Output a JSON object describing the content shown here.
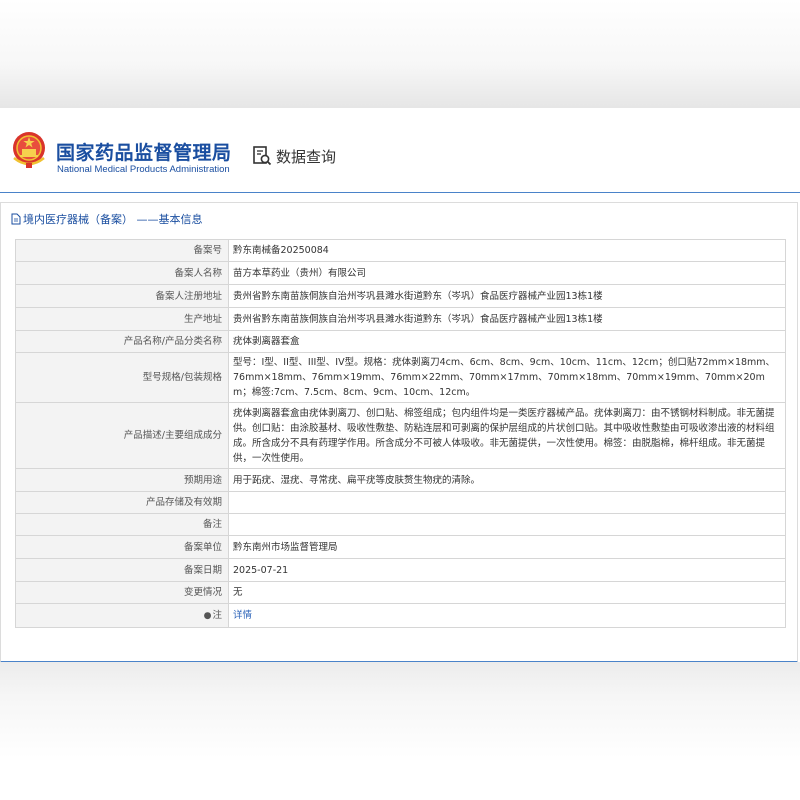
{
  "header": {
    "agency_cn": "国家药品监督管理局",
    "agency_en": "National Medical Products Administration",
    "query_label": "数据查询"
  },
  "section": {
    "title": "境内医疗器械（备案） ——基本信息"
  },
  "rows": [
    {
      "label": "备案号",
      "value": "黔东南械备20250084"
    },
    {
      "label": "备案人名称",
      "value": "苗方本草药业（贵州）有限公司"
    },
    {
      "label": "备案人注册地址",
      "value": "贵州省黔东南苗族侗族自治州岑巩县濉水街道黔东（岑巩）食品医疗器械产业园13栋1楼"
    },
    {
      "label": "生产地址",
      "value": "贵州省黔东南苗族侗族自治州岑巩县濉水街道黔东（岑巩）食品医疗器械产业园13栋1楼"
    },
    {
      "label": "产品名称/产品分类名称",
      "value": "疣体剥离器套盒"
    },
    {
      "label": "型号规格/包装规格",
      "value": "型号：I型、II型、III型、IV型。规格：疣体剥离刀4cm、6cm、8cm、9cm、10cm、11cm、12cm；创口贴72mm×18mm、76mm×18mm、76mm×19mm、76mm×22mm、70mm×17mm、70mm×18mm、70mm×19mm、70mm×20mm；棉签:7cm、7.5cm、8cm、9cm、10cm、12cm。"
    },
    {
      "label": "产品描述/主要组成成分",
      "value": "疣体剥离器套盒由疣体剥离刀、创口贴、棉签组成；包内组件均是一类医疗器械产品。疣体剥离刀：由不锈钢材料制成。非无菌提供。创口贴：由涂胶基材、吸收性敷垫、防粘连层和可剥离的保护层组成的片状创口贴。其中吸收性敷垫由可吸收渗出液的材料组成。所含成分不具有药理学作用。所含成分不可被人体吸收。非无菌提供，一次性使用。棉签：由脱脂棉，棉杆组成。非无菌提供，一次性使用。"
    },
    {
      "label": "预期用途",
      "value": "用于跖疣、湿疣、寻常疣、扁平疣等皮肤赘生物疣的清除。"
    },
    {
      "label": "产品存储及有效期",
      "value": ""
    },
    {
      "label": "备注",
      "value": ""
    },
    {
      "label": "备案单位",
      "value": "黔东南州市场监督管理局"
    },
    {
      "label": "备案日期",
      "value": "2025-07-21"
    },
    {
      "label": "变更情况",
      "value": "无"
    },
    {
      "label": "注",
      "value": "详情"
    }
  ],
  "colors": {
    "brand_blue": "#1a4ea0",
    "accent_line": "#4a83c9",
    "link": "#2a62b8"
  },
  "icons": {
    "emblem": "national-emblem-icon",
    "query": "magnifier-document-icon",
    "doc": "document-icon",
    "pin": "pin-icon"
  }
}
